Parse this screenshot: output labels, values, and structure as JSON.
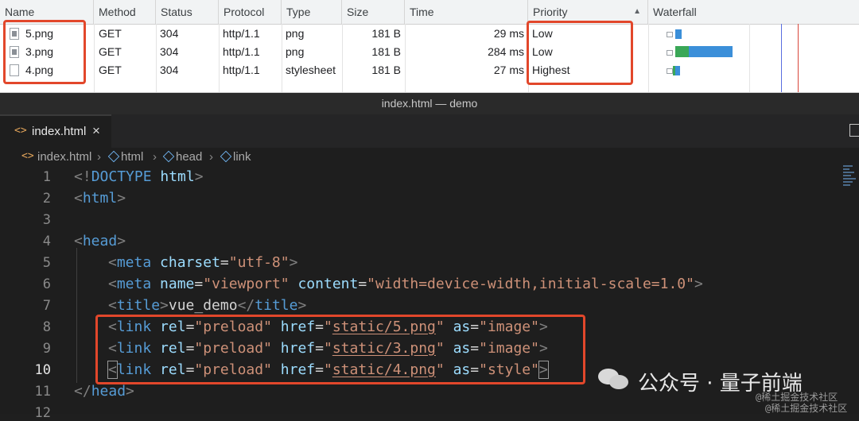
{
  "network": {
    "columns": [
      "Name",
      "Method",
      "Status",
      "Protocol",
      "Type",
      "Size",
      "Time",
      "Priority",
      "Waterfall"
    ],
    "sort_icon": "sort-ascending-icon",
    "rows": [
      {
        "name": "5.png",
        "method": "GET",
        "status": "304",
        "protocol": "http/1.1",
        "type": "png",
        "size": "181 B",
        "time": "29 ms",
        "priority": "Low",
        "icon": "image-file-icon"
      },
      {
        "name": "3.png",
        "method": "GET",
        "status": "304",
        "protocol": "http/1.1",
        "type": "png",
        "size": "181 B",
        "time": "284 ms",
        "priority": "Low",
        "icon": "image-file-icon"
      },
      {
        "name": "4.png",
        "method": "GET",
        "status": "304",
        "protocol": "http/1.1",
        "type": "stylesheet",
        "size": "181 B",
        "time": "27 ms",
        "priority": "Highest",
        "icon": "blank-file-icon"
      }
    ],
    "colors": {
      "highlight": "#e2472b",
      "waterfall_blue": "#3b8fd9",
      "waterfall_green": "#3aa757"
    }
  },
  "window": {
    "title": "index.html — demo"
  },
  "tabs": [
    {
      "label": "index.html",
      "close": "×",
      "icon": "code-icon"
    }
  ],
  "breadcrumb": {
    "file": "index.html",
    "items": [
      "html",
      "head",
      "link"
    ],
    "separator": "›"
  },
  "editor": {
    "line_numbers": [
      "1",
      "2",
      "3",
      "4",
      "5",
      "6",
      "7",
      "8",
      "9",
      "10",
      "11",
      "12"
    ],
    "current_line": "10",
    "code": {
      "l1_open": "<!",
      "l1_kw": "DOCTYPE",
      "l1_rest": " html",
      "l1_close": ">",
      "html": "html",
      "head": "head",
      "meta": "meta",
      "charset_attr": "charset",
      "charset_val": "\"utf-8\"",
      "name_attr": "name",
      "name_val": "\"viewport\"",
      "content_attr": "content",
      "content_val": "\"width=device-width,initial-scale=1.0\"",
      "title_tag": "title",
      "title_text": "vue_demo",
      "link": "link",
      "rel_attr": "rel",
      "rel_val": "\"preload\"",
      "href_attr": "href",
      "as_attr": "as",
      "href_5": "static/5.png",
      "href_3": "static/3.png",
      "href_4": "static/4.png",
      "as_image": "\"image\"",
      "as_style": "\"style\""
    }
  },
  "watermark": {
    "name": "公众号 · 量子前端",
    "sub1": "@稀土掘金技术社区",
    "sub2": "@稀土掘金技术社区"
  }
}
